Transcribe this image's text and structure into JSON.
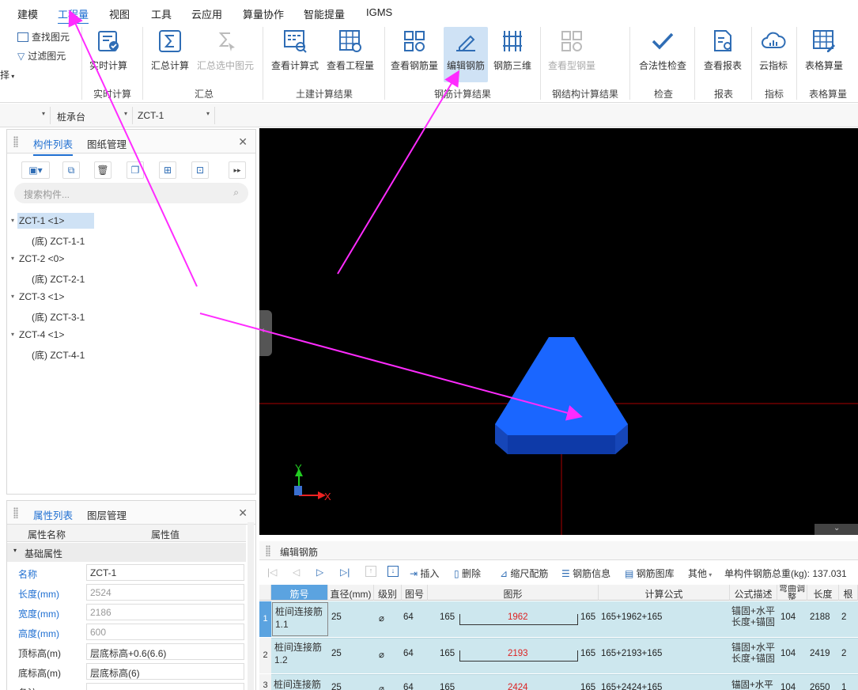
{
  "menu": {
    "items": [
      "建模",
      "工程量",
      "视图",
      "工具",
      "云应用",
      "算量协作",
      "智能提量",
      "IGMS"
    ],
    "active": "工程量"
  },
  "ribbon": {
    "left_items": [
      "查找图元",
      "过滤图元"
    ],
    "left_edge": "择",
    "buttons": {
      "realtime_calc": "实时计算",
      "summary_calc": "汇总计算",
      "summary_selected": "汇总选中图元",
      "view_formula": "查看计算式",
      "view_quantity": "查看工程量",
      "view_rebar": "查看钢筋量",
      "edit_rebar": "编辑钢筋",
      "rebar_3d": "钢筋三维",
      "view_steel": "查看型钢量",
      "legality_check": "合法性检查",
      "view_report": "查看报表",
      "cloud_index": "云指标",
      "table_calc": "表格算量"
    },
    "groups": {
      "realtime": "实时计算",
      "summary": "汇总",
      "civil_results": "土建计算结果",
      "rebar_results": "钢筋计算结果",
      "steel_results": "钢结构计算结果",
      "check": "检查",
      "report": "报表",
      "index": "指标",
      "table": "表格算量"
    }
  },
  "toolbar2": {
    "type_select": "桩承台",
    "item_select": "ZCT-1"
  },
  "component_panel": {
    "tabs": [
      "构件列表",
      "图纸管理"
    ],
    "search_placeholder": "搜索构件...",
    "tree": [
      {
        "label": "ZCT-1 <1>",
        "child": "(底) ZCT-1-1"
      },
      {
        "label": "ZCT-2 <0>",
        "child": "(底) ZCT-2-1"
      },
      {
        "label": "ZCT-3 <1>",
        "child": "(底) ZCT-3-1"
      },
      {
        "label": "ZCT-4 <1>",
        "child": "(底) ZCT-4-1"
      }
    ]
  },
  "property_panel": {
    "tabs": [
      "属性列表",
      "图层管理"
    ],
    "col_name": "属性名称",
    "col_value": "属性值",
    "group": "基础属性",
    "rows": [
      {
        "key": "名称",
        "value": "ZCT-1"
      },
      {
        "key": "长度(mm)",
        "value": "2524"
      },
      {
        "key": "宽度(mm)",
        "value": "2186"
      },
      {
        "key": "高度(mm)",
        "value": "600"
      },
      {
        "key": "顶标高(m)",
        "value": "层底标高+0.6(6.6)"
      },
      {
        "key": "底标高(m)",
        "value": "层底标高(6)"
      },
      {
        "key": "备注",
        "value": ""
      }
    ]
  },
  "viewport": {
    "axis_x": "X",
    "axis_y": "Y",
    "shape_color": "#1a66ff",
    "arrow_color": "#ff2bff"
  },
  "rebar_panel": {
    "title": "编辑钢筋",
    "actions": [
      "插入",
      "删除",
      "缩尺配筋",
      "钢筋信息",
      "钢筋图库",
      "其他"
    ],
    "total": "单构件钢筋总重(kg): 137.031",
    "headers": [
      "筋号",
      "直径(mm)",
      "级别",
      "图号",
      "图形",
      "计算公式",
      "公式描述",
      "弯曲调整",
      "长度",
      "根"
    ],
    "rows": [
      {
        "idx": "1",
        "name": "桩间连接筋1.1",
        "dia": "25",
        "grade": "⌀",
        "fig": "64",
        "left": "165",
        "mid": "1962",
        "right": "165",
        "formula": "165+1962+165",
        "desc": "锚固+水平长度+锚固",
        "bend": "104",
        "len": "2188",
        "count": "2"
      },
      {
        "idx": "2",
        "name": "桩间连接筋1.2",
        "dia": "25",
        "grade": "⌀",
        "fig": "64",
        "left": "165",
        "mid": "2193",
        "right": "165",
        "formula": "165+2193+165",
        "desc": "锚固+水平长度+锚固",
        "bend": "104",
        "len": "2419",
        "count": "2"
      },
      {
        "idx": "3",
        "name": "桩间连接筋",
        "dia": "25",
        "grade": "⌀",
        "fig": "64",
        "left": "165",
        "mid": "2424",
        "right": "165",
        "formula": "165+2424+165",
        "desc": "锚固+水平",
        "bend": "104",
        "len": "2650",
        "count": "1"
      }
    ]
  }
}
